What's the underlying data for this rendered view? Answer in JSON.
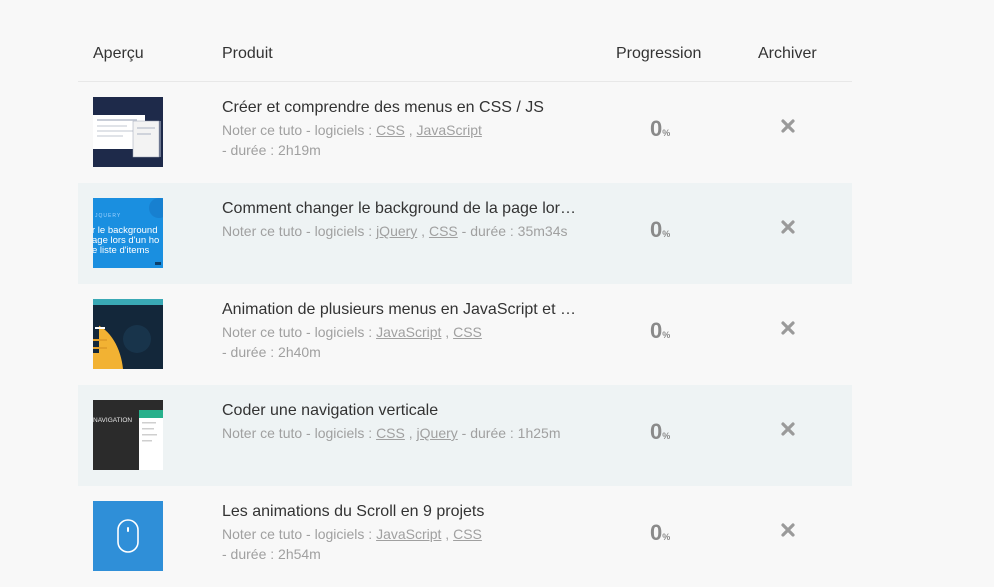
{
  "headers": {
    "preview": "Aperçu",
    "product": "Produit",
    "progress": "Progression",
    "archive": "Archiver"
  },
  "rows": [
    {
      "title": "Créer et comprendre des menus en CSS / JS",
      "prefix": "Noter ce tuto - logiciels : ",
      "softwares": [
        "CSS",
        "JavaScript"
      ],
      "duration": "- durée : 2h19m",
      "progress": "0",
      "unit": "%"
    },
    {
      "title": "Comment changer le background de la page lors d'un hover sur une liste d'items",
      "prefix": "Noter ce tuto - logiciels : ",
      "softwares": [
        "jQuery",
        "CSS"
      ],
      "duration": "- durée : 35m34s",
      "progress": "0",
      "unit": "%"
    },
    {
      "title": "Animation de plusieurs menus en JavaScript et CSS",
      "prefix": "Noter ce tuto - logiciels : ",
      "softwares": [
        "JavaScript",
        "CSS"
      ],
      "duration": "- durée : 2h40m",
      "progress": "0",
      "unit": "%"
    },
    {
      "title": "Coder une navigation verticale",
      "prefix": "Noter ce tuto - logiciels : ",
      "softwares": [
        "CSS",
        "jQuery"
      ],
      "duration": "- durée : 1h25m",
      "progress": "0",
      "unit": "%"
    },
    {
      "title": "Les animations du Scroll en 9 projets",
      "prefix": "Noter ce tuto - logiciels : ",
      "softwares": [
        "JavaScript",
        "CSS"
      ],
      "duration": "- durée : 2h54m",
      "progress": "0",
      "unit": "%"
    }
  ],
  "thumbs": {
    "t2_kicker": "JQUERY",
    "t2_lines": [
      "r le background",
      "age lors d'un ho",
      "e liste d'items"
    ],
    "t4_label": "NAVIGATION"
  },
  "icons": {
    "archive": "close-icon"
  }
}
